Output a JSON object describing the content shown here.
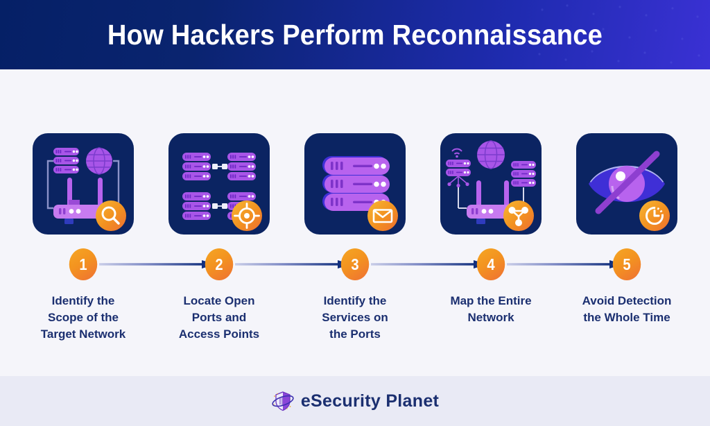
{
  "header": {
    "title": "How Hackers Perform Reconnaissance",
    "gradient_start": "#052066",
    "gradient_end": "#3a31d4"
  },
  "theme": {
    "page_background": "#f5f5fa",
    "footer_background": "#e9eaf5",
    "card_background": "#0b2462",
    "label_color": "#1b2f70",
    "accent_orange": "#f39320",
    "accent_orange_deep": "#ef7034",
    "icon_purple": "#b05ce0",
    "icon_purple_light": "#c77bf0",
    "icon_blue": "#3a31d4",
    "arrow_color": "#12307e"
  },
  "steps": [
    {
      "number": "1",
      "label": "Identify the\nScope of the\nTarget Network",
      "icon_name": "router-globe-servers-search-icon",
      "badge_icon": "magnifier-icon"
    },
    {
      "number": "2",
      "label": "Locate Open\nPorts and\nAccess Points",
      "icon_name": "linked-server-racks-target-icon",
      "badge_icon": "crosshair-target-icon"
    },
    {
      "number": "3",
      "label": "Identify the\nServices on\nthe Ports",
      "icon_name": "server-rack-mail-icon",
      "badge_icon": "envelope-icon"
    },
    {
      "number": "4",
      "label": "Map the Entire\nNetwork",
      "icon_name": "network-map-router-globe-icon",
      "badge_icon": "share-nodes-icon"
    },
    {
      "number": "5",
      "label": "Avoid Detection\nthe Whole Time",
      "icon_name": "hidden-eye-clock-icon",
      "badge_icon": "clock-icon"
    }
  ],
  "footer": {
    "brand": "eSecurity Planet",
    "logo_icon": "shield-orbit-logo-icon"
  }
}
